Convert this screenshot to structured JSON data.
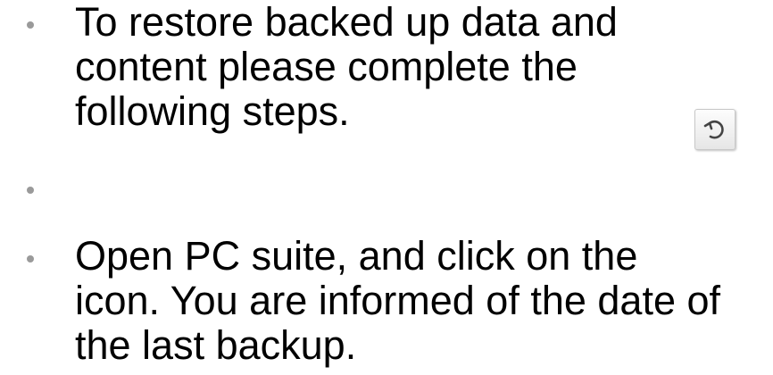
{
  "bullets": [
    {
      "text": "To restore backed up data and\ncontent please complete the\nfollowing steps."
    },
    {
      "text": ""
    },
    {
      "text": "Open PC suite, and click on the\nicon. You are informed of the date of\nthe last backup."
    }
  ],
  "restore_icon": {
    "name": "restore-icon",
    "stroke_color": "#444444",
    "face_color": "#f2f2f2"
  }
}
